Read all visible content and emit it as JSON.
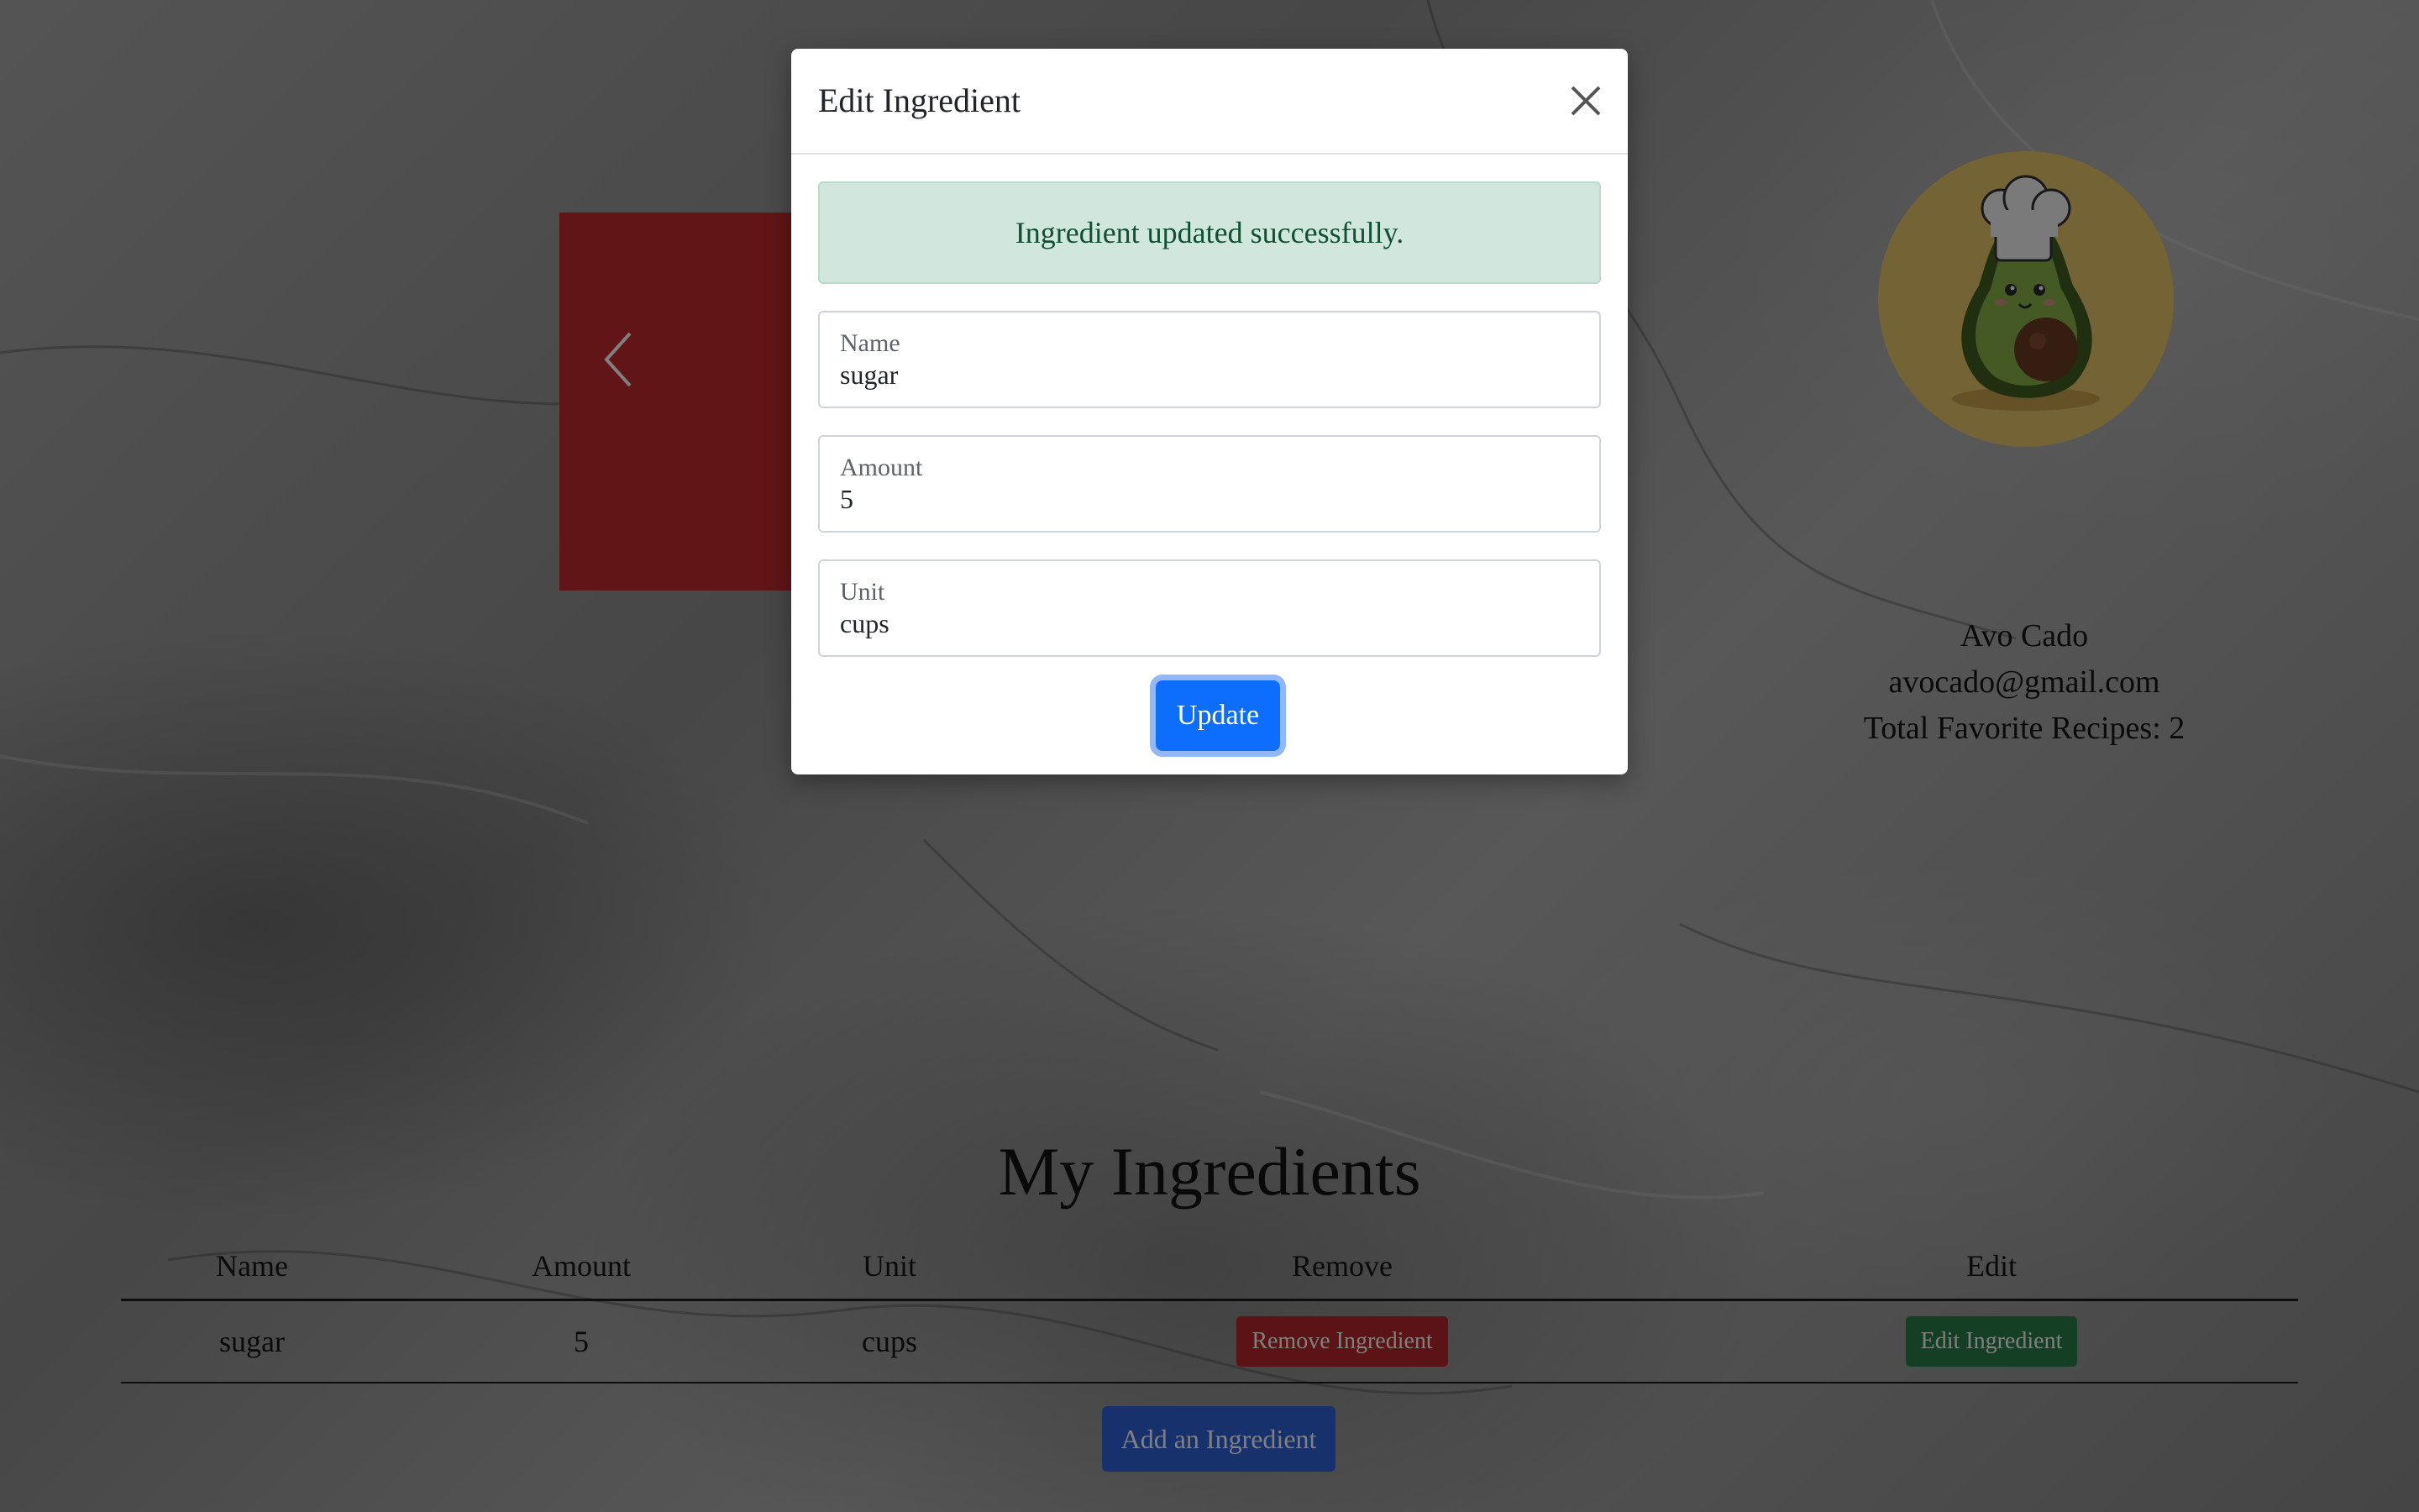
{
  "profile": {
    "name": "Avo Cado",
    "email": "avocado@gmail.com",
    "favorites": "Total Favorite Recipes: 2"
  },
  "ingredients": {
    "title": "My Ingredients",
    "headers": [
      "Name",
      "Amount",
      "Unit",
      "Remove",
      "Edit"
    ],
    "rows": [
      {
        "name": "sugar",
        "amount": "5",
        "unit": "cups",
        "remove_label": "Remove Ingredient",
        "edit_label": "Edit Ingredient"
      }
    ],
    "add_label": "Add an Ingredient"
  },
  "modal": {
    "title": "Edit Ingredient",
    "alert": "Ingredient updated successfully.",
    "fields": [
      {
        "label": "Name",
        "value": "sugar"
      },
      {
        "label": "Amount",
        "value": "5"
      },
      {
        "label": "Unit",
        "value": "cups"
      }
    ],
    "submit_label": "Update"
  },
  "colors": {
    "carousel": "#c42a2e",
    "primary": "#0d6efd",
    "danger": "#b8262b",
    "success": "#2a7f4a",
    "alert_bg": "#d1e7dd"
  },
  "icons": {
    "carousel_prev": "chevron-left-icon",
    "modal_close": "close-icon",
    "avatar": "avocado-chef-icon"
  }
}
